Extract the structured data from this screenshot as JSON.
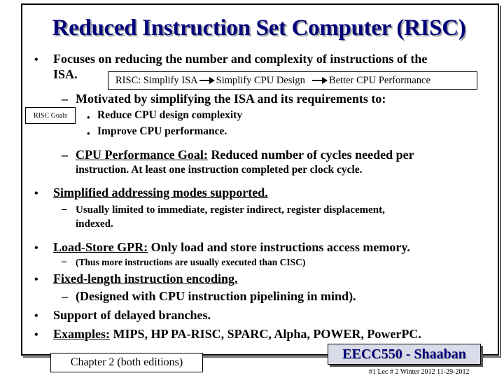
{
  "slide": {
    "title": "Reduced Instruction Set Computer (RISC)",
    "bullets": {
      "b1": "Focuses on reducing the number and complexity of instructions of the",
      "b1_cont": "ISA.",
      "b1_sub1": "Motivated by simplifying the ISA and its requirements to:",
      "b1_sub1_items": [
        "Reduce CPU design complexity",
        "Improve CPU performance."
      ],
      "b1_sub2_label": "CPU Performance Goal:",
      "b1_sub2_text": " Reduced number of cycles needed per",
      "b1_sub2_cont": "instruction.   At least one instruction completed per clock cycle.",
      "b2": "Simplified addressing modes supported.",
      "b2_sub1": "Usually limited to immediate, register indirect, register displacement,",
      "b2_sub1_cont": "indexed.",
      "b3_label": "Load-Store GPR:",
      "b3_text": " Only load and store instructions access memory.",
      "b3_sub1": "(Thus more instructions are usually executed than CISC)",
      "b4": "Fixed-length instruction encoding.",
      "b4_sub1": "(Designed with CPU instruction pipelining in mind).",
      "b5": "Support of delayed branches.",
      "b6_label": "Examples:",
      "b6_text": " MIPS, HP PA-RISC, SPARC, Alpha, POWER, PowerPC."
    },
    "bullet_glyph": "•",
    "dash_glyph": "–",
    "risc_box": {
      "part1": "RISC: Simplify ISA",
      "part2": "Simplify CPU Design",
      "part3": "Better CPU Performance"
    },
    "goals_label": "RISC Goals",
    "chapter_label": "Chapter 2 (both editions)",
    "footer_badge": "EECC550 - Shaaban",
    "footer_info": "#1   Lec # 2   Winter 2012  11-29-2012"
  },
  "colors": {
    "title": "#00007a",
    "badge_bg": "#d9dbe8"
  }
}
